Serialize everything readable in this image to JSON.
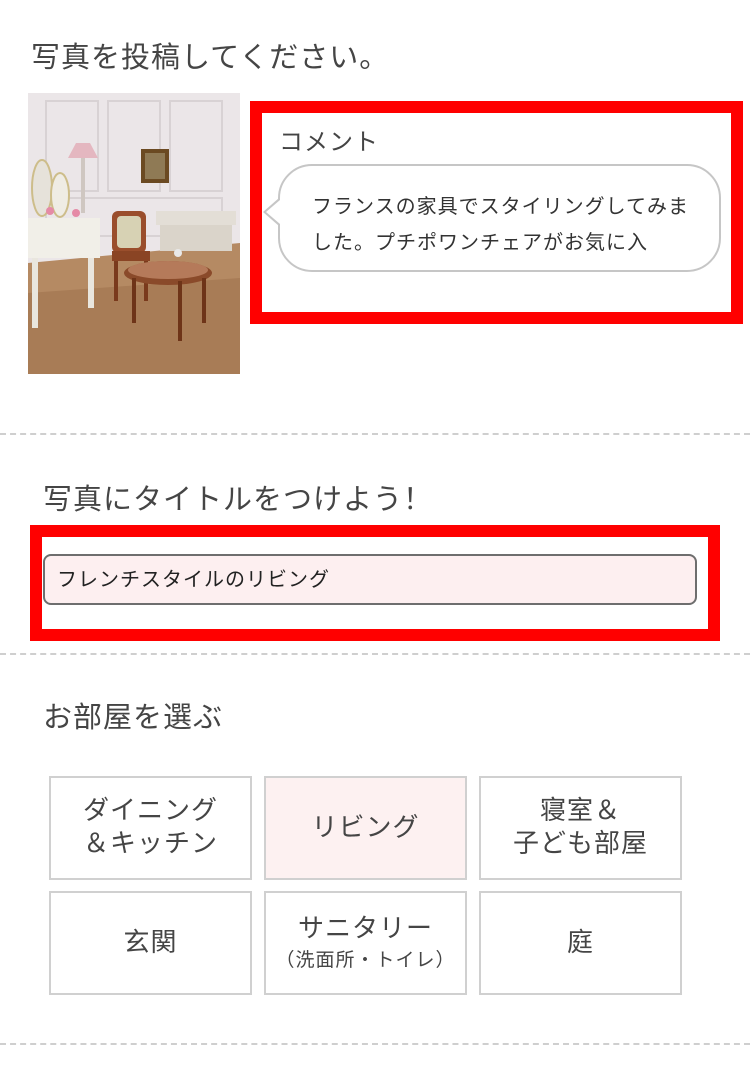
{
  "photo_section": {
    "heading": "写真を投稿してください。"
  },
  "comment": {
    "label": "コメント",
    "text": "フランスの家具でスタイリングしてみました。プチポワンチェアがお気に入"
  },
  "title_section": {
    "heading": "写真にタイトルをつけよう！",
    "value": "フレンチスタイルのリビング"
  },
  "room_section": {
    "heading": "お部屋を選ぶ",
    "rooms": [
      {
        "line1": "ダイニング",
        "line2": "＆キッチン",
        "selected": false
      },
      {
        "line1": "リビング",
        "line2": "",
        "selected": true
      },
      {
        "line1": "寝室＆",
        "line2": "子ども部屋",
        "selected": false
      },
      {
        "line1": "玄関",
        "line2": "",
        "selected": false
      },
      {
        "line1": "サニタリー",
        "line2": "（洗面所・トイレ）",
        "selected": false
      },
      {
        "line1": "庭",
        "line2": "",
        "selected": false
      }
    ]
  },
  "colors": {
    "highlight": "#ff0000",
    "selected_bg": "#fdf1f1",
    "input_bg": "#fdeff0"
  }
}
